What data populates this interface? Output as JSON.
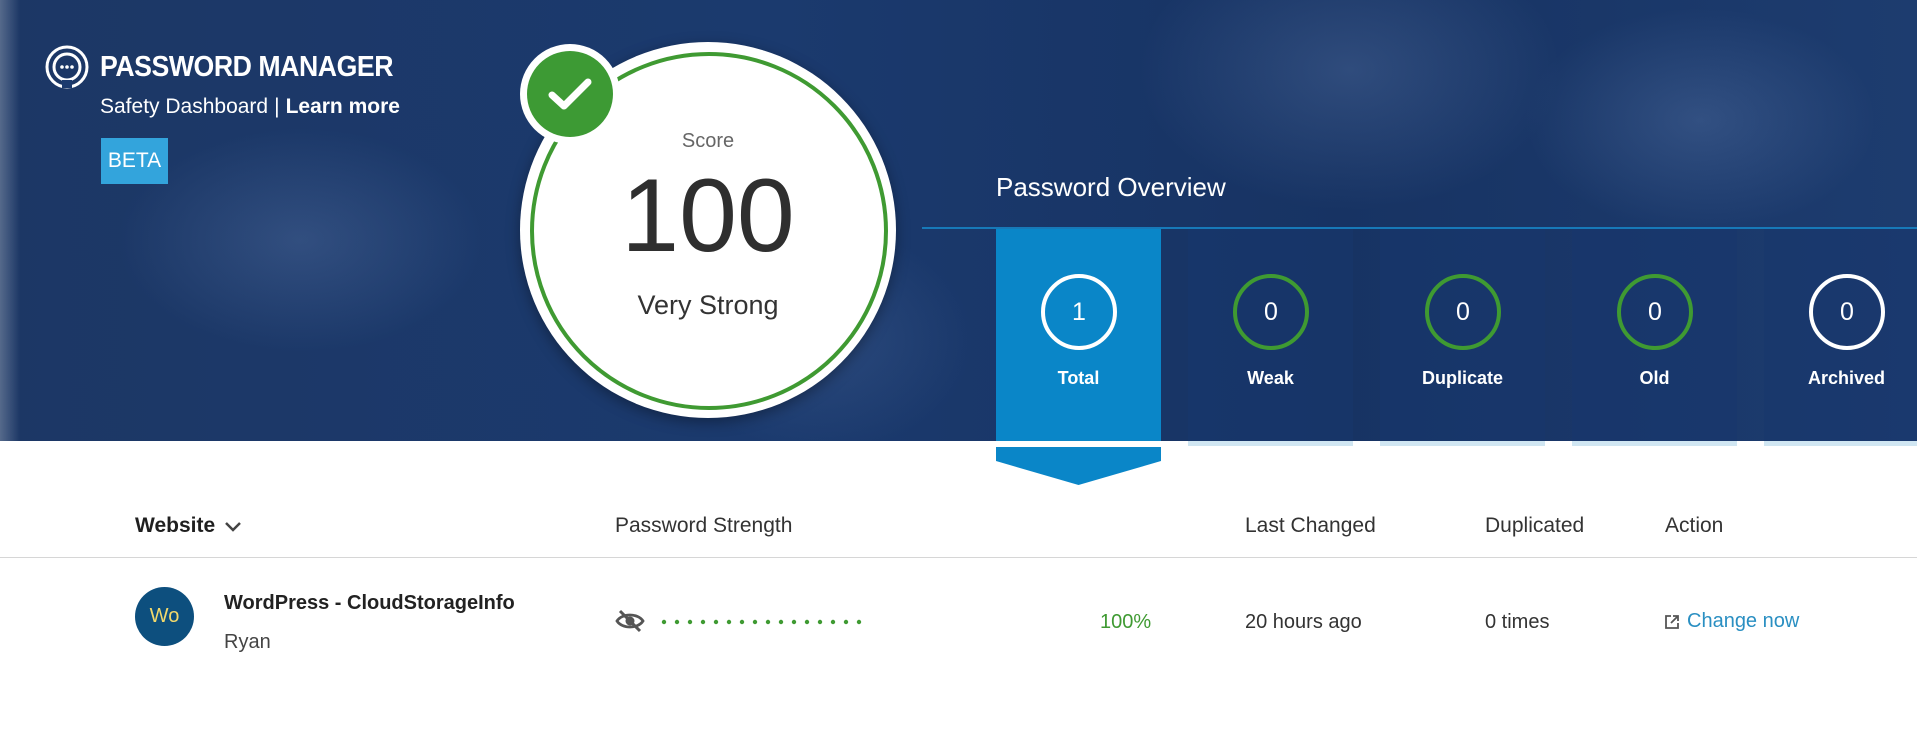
{
  "header": {
    "title": "PASSWORD MANAGER",
    "subtitle": "Safety Dashboard",
    "separator": "|",
    "learn_more": "Learn more",
    "badge": "BETA",
    "logo_icon": "password-manager-logo-icon"
  },
  "score": {
    "label": "Score",
    "value": "100",
    "rating": "Very Strong",
    "status_icon": "checkmark-icon",
    "ring_color": "#3f9a32"
  },
  "overview": {
    "title": "Password Overview",
    "tiles": [
      {
        "count": "1",
        "label": "Total",
        "active": true
      },
      {
        "count": "0",
        "label": "Weak",
        "active": false
      },
      {
        "count": "0",
        "label": "Duplicate",
        "active": false
      },
      {
        "count": "0",
        "label": "Old",
        "active": false
      },
      {
        "count": "0",
        "label": "Archived",
        "active": false
      }
    ]
  },
  "table": {
    "columns": {
      "website": "Website",
      "strength": "Password Strength",
      "last_changed": "Last Changed",
      "duplicated": "Duplicated",
      "action": "Action"
    },
    "rows": [
      {
        "avatar": "Wo",
        "site": "WordPress - CloudStorageInfo",
        "user": "Ryan",
        "strength_percent": "100%",
        "masked_password": "•••••••••••••••••",
        "last_changed": "20 hours ago",
        "duplicated": "0 times",
        "action": "Change now"
      }
    ]
  },
  "colors": {
    "accent": "#0a86c8",
    "good": "#3f9a32",
    "link": "#2a8fc2",
    "hero_bg": "#1b3a6e"
  }
}
